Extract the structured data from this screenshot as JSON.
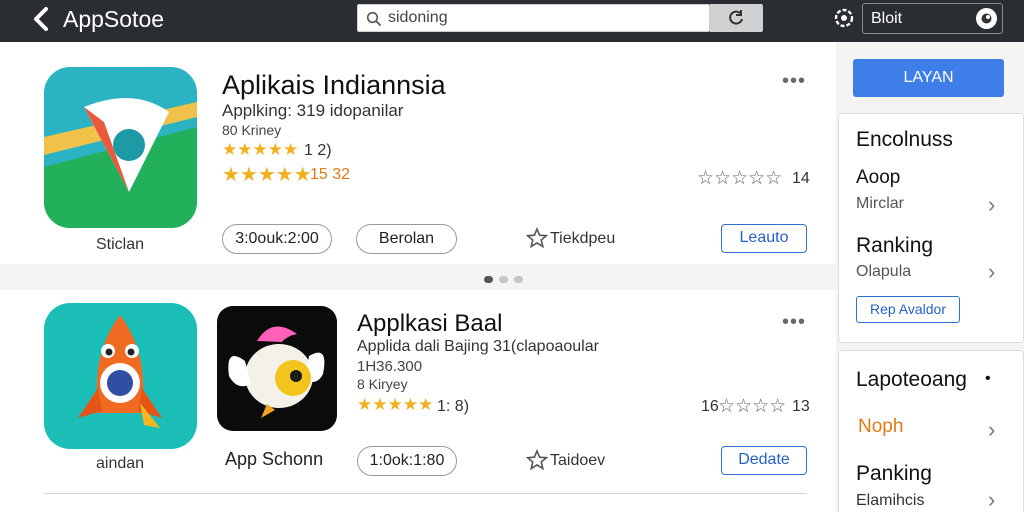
{
  "topbar": {
    "app_title": "AppSotoe",
    "search_placeholder": "sidoning",
    "user_label": "Bloit"
  },
  "apps": [
    {
      "title": "Aplikais Indiannsia",
      "subtitle": "Applking: 319 idopanilar",
      "meta": "80 Kriney",
      "rating_small_count": "1 2)",
      "rating_large_count": "15 32",
      "review_count": "14",
      "icon_caption": "Sticlan",
      "price_label": "3:0ouk:2:00",
      "secondary_label": "Berolan",
      "wishlist_label": "Tiekdpeu",
      "action_label": "Leauto"
    },
    {
      "title": "Applkasi Baal",
      "subtitle": "Applida dali Bajing 31(clapoaoular",
      "meta_line1": "1H36.300",
      "meta_line2": "8 Kiryey",
      "rating_count": "1: 8)",
      "review_prefix": "16",
      "review_count": "13",
      "icon_caption": "aindan",
      "icon2_caption": "App Schonn",
      "price_label": "1:0ok:1:80",
      "wishlist_label": "Taidoev",
      "action_label": "Dedate"
    }
  ],
  "sidebar": {
    "primary_button": "LAYAN",
    "panel1": {
      "heading": "Encolnuss",
      "item1_title": "Aoop",
      "item1_sub": "Mirclar",
      "item2_title": "Ranking",
      "item2_sub": "Olapula",
      "button": "Rep Avaldor"
    },
    "panel2": {
      "heading": "Lapoteoang",
      "item1_title": "Noph",
      "item2_title": "Panking",
      "item2_sub": "Elamihcis"
    }
  },
  "colors": {
    "topbar": "#2a2d31",
    "accent_blue": "#3e7ee8",
    "star_gold": "#f1b01e",
    "orange": "#e07b16"
  }
}
